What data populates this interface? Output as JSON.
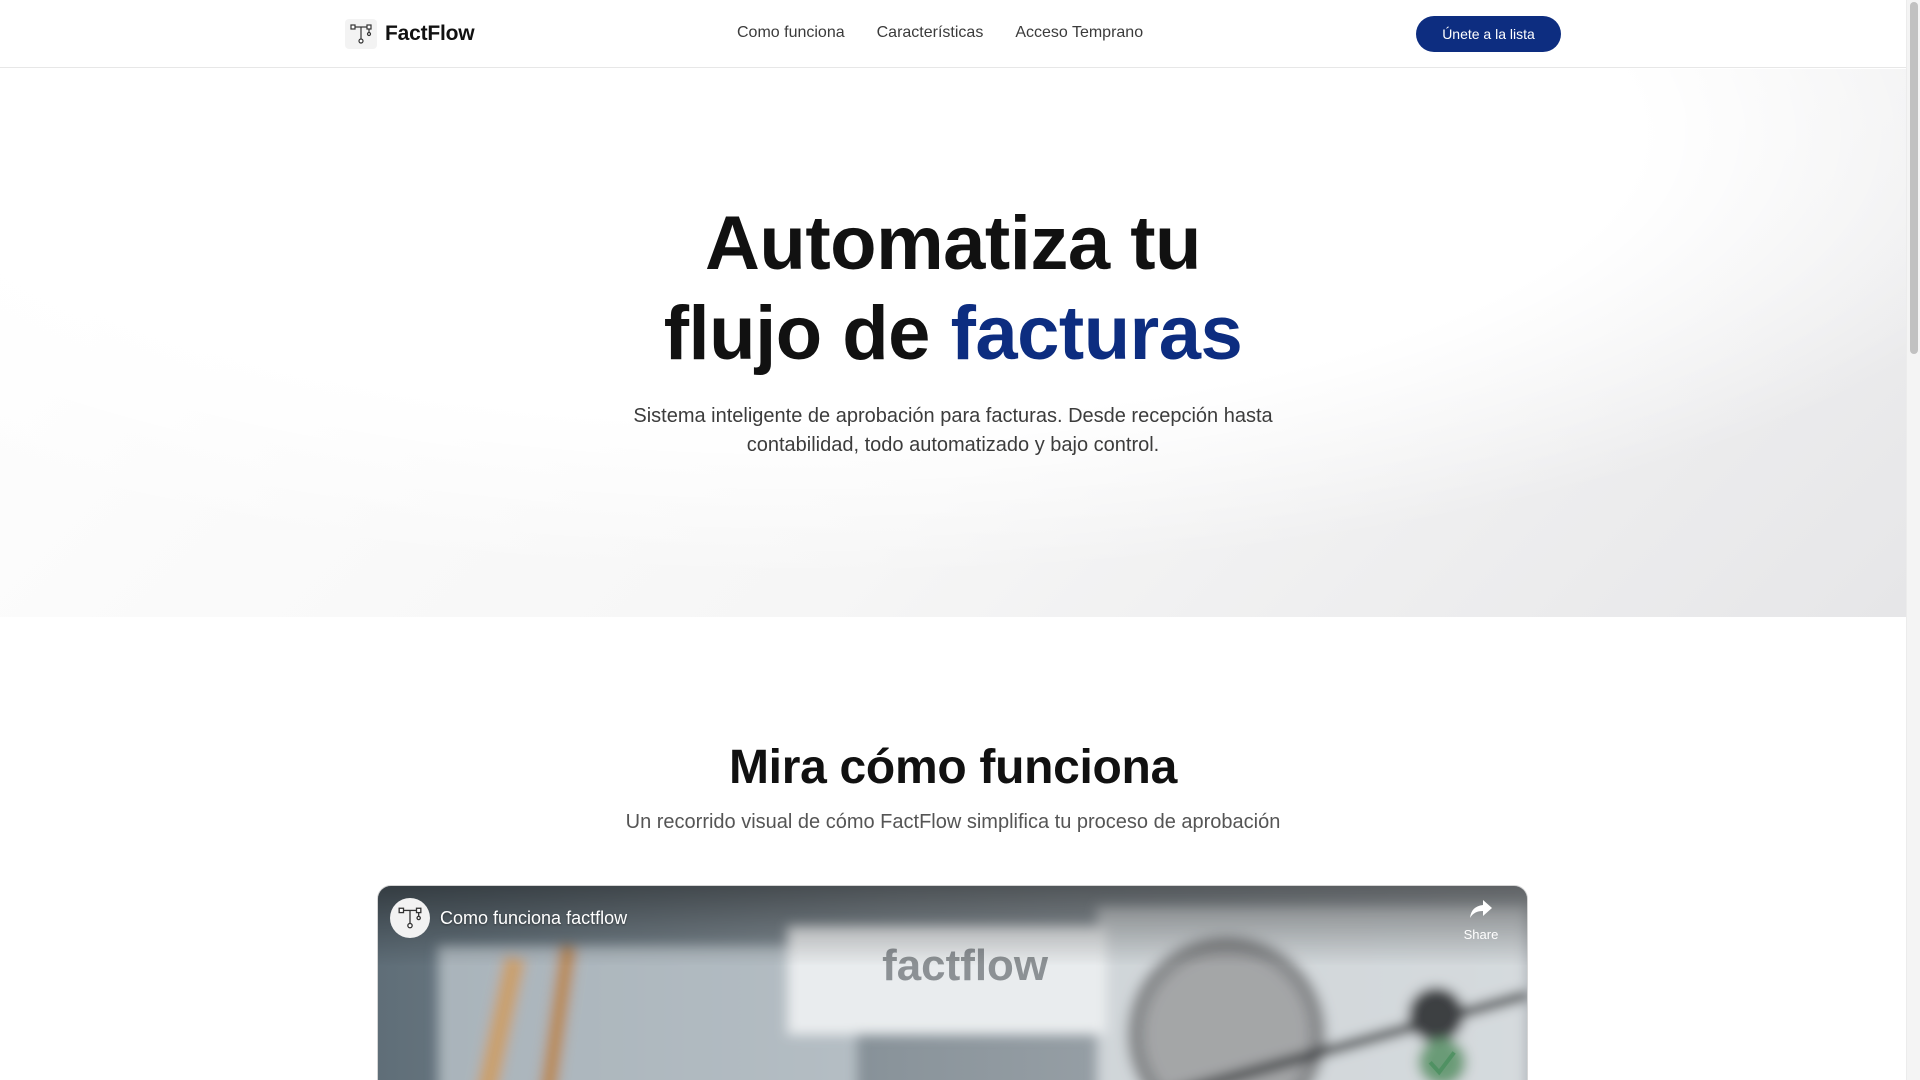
{
  "header": {
    "brand": "FactFlow",
    "logo_icon": "workflow-nodes-icon",
    "nav": [
      "Como funciona",
      "Características",
      "Acceso Temprano"
    ],
    "cta": "Únete a la lista"
  },
  "hero": {
    "title_line1": "Automatiza tu",
    "title_line2_prefix": "flujo de ",
    "title_line2_accent": "facturas",
    "subtitle_line1": "Sistema inteligente de aprobación para facturas. Desde recepción hasta",
    "subtitle_line2": "contabilidad, todo automatizado y bajo control."
  },
  "video_section": {
    "title": "Mira cómo funciona",
    "subtitle": "Un recorrido visual de cómo FactFlow simplifica tu proceso de aprobación",
    "player": {
      "video_title": "Como funciona factflow",
      "share_label": "Share",
      "thumbnail_text": "factflow"
    }
  },
  "colors": {
    "brand": "#0d2d80",
    "text": "#111111",
    "muted": "#555555"
  }
}
